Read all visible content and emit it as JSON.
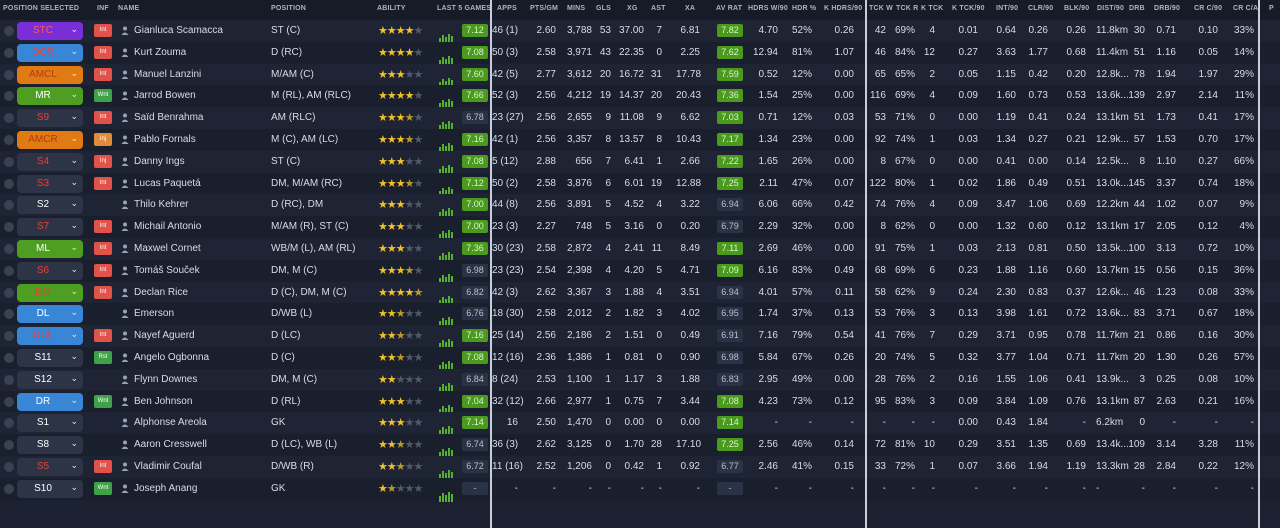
{
  "columns": {
    "position_selected": "POSITION SELECTED",
    "inf": "INF",
    "name": "NAME",
    "position": "POSITION",
    "ability": "ABILITY",
    "last5": "LAST 5 GAMES",
    "apps": "APPS",
    "pts_gm": "PTS/GM",
    "mins": "MINS",
    "gls": "GLS",
    "xg": "XG",
    "ast": "AST",
    "xa": "XA",
    "av_rat": "AV RAT",
    "hdrs_w90": "HDRS W/90",
    "hdr_pct": "HDR %",
    "khdrs90": "K HDRS/90",
    "tckw": "TCK W",
    "tckr": "TCK R",
    "ktck": "K TCK",
    "ktck90": "K TCK/90",
    "int90": "INT/90",
    "clr90": "CLR/90",
    "blk90": "BLK/90",
    "dist90": "DIST/90",
    "drb": "DRB",
    "drb90": "DRB/90",
    "crc90": "CR C/90",
    "crca": "CR C/A",
    "p": "P"
  },
  "colors": {
    "purple": "#7a2fd6",
    "blue": "#3a86d6",
    "orange": "#e07a12",
    "green": "#4e9e22",
    "dark": "#2c3446",
    "red": "#e04840",
    "text_red": "#e8423a"
  },
  "rows": [
    {
      "pos": "STC",
      "pos_style": "purple",
      "inf": "Int",
      "inf_color": "red",
      "name": "Gianluca Scamacca",
      "position": "ST (C)",
      "stars": 4,
      "half": false,
      "rating": "7.12",
      "rating_bg": "green",
      "apps": "46 (1)",
      "pts_gm": "2.60",
      "mins": "3,788",
      "gls": "53",
      "xg": "37.00",
      "ast": "7",
      "xa": "6.81",
      "av_rat": "7.82",
      "av_bg": "green",
      "hdrs_w90": "4.70",
      "hdr_pct": "52%",
      "khdrs90": "0.26",
      "tckw": "42",
      "tckr": "69%",
      "ktck": "4",
      "ktck90": "0.01",
      "int90": "0.64",
      "clr90": "0.26",
      "blk90": "0.26",
      "dist90": "11.8km",
      "drb": "30",
      "drb90": "0.71",
      "crc90": "0.10",
      "crca": "33%"
    },
    {
      "pos": "DCR",
      "pos_style": "blue",
      "inf": "Int",
      "inf_color": "red",
      "name": "Kurt Zouma",
      "position": "D (RC)",
      "stars": 4,
      "half": false,
      "rating": "7.08",
      "rating_bg": "green",
      "apps": "50 (3)",
      "pts_gm": "2.58",
      "mins": "3,971",
      "gls": "43",
      "xg": "22.35",
      "ast": "0",
      "xa": "2.25",
      "av_rat": "7.62",
      "av_bg": "green",
      "hdrs_w90": "12.94",
      "hdr_pct": "81%",
      "khdrs90": "1.07",
      "tckw": "46",
      "tckr": "84%",
      "ktck": "12",
      "ktck90": "0.27",
      "int90": "3.63",
      "clr90": "1.77",
      "blk90": "0.68",
      "dist90": "11.4km",
      "drb": "51",
      "drb90": "1.16",
      "crc90": "0.05",
      "crca": "14%"
    },
    {
      "pos": "AMCL",
      "pos_style": "orange",
      "inf": "Int",
      "inf_color": "red",
      "name": "Manuel Lanzini",
      "position": "M/AM (C)",
      "stars": 3,
      "half": false,
      "rating": "7.60",
      "rating_bg": "green",
      "apps": "42 (5)",
      "pts_gm": "2.77",
      "mins": "3,612",
      "gls": "20",
      "xg": "16.72",
      "ast": "31",
      "xa": "17.78",
      "av_rat": "7.59",
      "av_bg": "green",
      "hdrs_w90": "0.52",
      "hdr_pct": "12%",
      "khdrs90": "0.00",
      "tckw": "65",
      "tckr": "65%",
      "ktck": "2",
      "ktck90": "0.05",
      "int90": "1.15",
      "clr90": "0.42",
      "blk90": "0.20",
      "dist90": "12.8k...",
      "drb": "78",
      "drb90": "1.94",
      "crc90": "1.97",
      "crca": "29%"
    },
    {
      "pos": "MR",
      "pos_style": "green",
      "inf": "Wnt",
      "inf_color": "green",
      "name": "Jarrod Bowen",
      "position": "M (RL), AM (RLC)",
      "stars": 4,
      "half": false,
      "rating": "7.66",
      "rating_bg": "green",
      "apps": "52 (3)",
      "pts_gm": "2.56",
      "mins": "4,212",
      "gls": "19",
      "xg": "14.37",
      "ast": "20",
      "xa": "20.43",
      "av_rat": "7.36",
      "av_bg": "green",
      "hdrs_w90": "1.54",
      "hdr_pct": "25%",
      "khdrs90": "0.00",
      "tckw": "116",
      "tckr": "69%",
      "ktck": "4",
      "ktck90": "0.09",
      "int90": "1.60",
      "clr90": "0.73",
      "blk90": "0.53",
      "dist90": "13.6k...",
      "drb": "139",
      "drb90": "2.97",
      "crc90": "2.14",
      "crca": "11%"
    },
    {
      "pos": "S9",
      "pos_style": "dark",
      "inf": "Int",
      "inf_color": "red",
      "name": "Saïd Benrahma",
      "position": "AM (RLC)",
      "stars": 3,
      "half": true,
      "rating": "6.78",
      "rating_bg": "dark",
      "apps": "23 (27)",
      "pts_gm": "2.56",
      "mins": "2,655",
      "gls": "9",
      "xg": "11.08",
      "ast": "9",
      "xa": "6.62",
      "av_rat": "7.03",
      "av_bg": "green",
      "hdrs_w90": "0.71",
      "hdr_pct": "12%",
      "khdrs90": "0.03",
      "tckw": "53",
      "tckr": "71%",
      "ktck": "0",
      "ktck90": "0.00",
      "int90": "1.19",
      "clr90": "0.41",
      "blk90": "0.24",
      "dist90": "13.1km",
      "drb": "51",
      "drb90": "1.73",
      "crc90": "0.41",
      "crca": "17%"
    },
    {
      "pos": "AMCR",
      "pos_style": "orange",
      "inf": "Inj",
      "inf_color": "orange",
      "name": "Pablo Fornals",
      "position": "M (C), AM (LC)",
      "stars": 3,
      "half": true,
      "rating": "7.16",
      "rating_bg": "green",
      "apps": "42 (1)",
      "pts_gm": "2.56",
      "mins": "3,357",
      "gls": "8",
      "xg": "13.57",
      "ast": "8",
      "xa": "10.43",
      "av_rat": "7.17",
      "av_bg": "green",
      "hdrs_w90": "1.34",
      "hdr_pct": "23%",
      "khdrs90": "0.00",
      "tckw": "92",
      "tckr": "74%",
      "ktck": "1",
      "ktck90": "0.03",
      "int90": "1.34",
      "clr90": "0.27",
      "blk90": "0.21",
      "dist90": "12.9k...",
      "drb": "57",
      "drb90": "1.53",
      "crc90": "0.70",
      "crca": "17%"
    },
    {
      "pos": "S4",
      "pos_style": "dark",
      "inf": "Inj",
      "inf_color": "red",
      "name": "Danny Ings",
      "position": "ST (C)",
      "stars": 3,
      "half": false,
      "rating": "7.08",
      "rating_bg": "green",
      "apps": "5 (12)",
      "pts_gm": "2.88",
      "mins": "656",
      "gls": "7",
      "xg": "6.41",
      "ast": "1",
      "xa": "2.66",
      "av_rat": "7.22",
      "av_bg": "green",
      "hdrs_w90": "1.65",
      "hdr_pct": "26%",
      "khdrs90": "0.00",
      "tckw": "8",
      "tckr": "67%",
      "ktck": "0",
      "ktck90": "0.00",
      "int90": "0.41",
      "clr90": "0.00",
      "blk90": "0.14",
      "dist90": "12.5k...",
      "drb": "8",
      "drb90": "1.10",
      "crc90": "0.27",
      "crca": "66%"
    },
    {
      "pos": "S3",
      "pos_style": "dark",
      "inf": "Int",
      "inf_color": "red",
      "name": "Lucas Paquetá",
      "position": "DM, M/AM (RC)",
      "stars": 3,
      "half": true,
      "rating": "7.12",
      "rating_bg": "green",
      "apps": "50 (2)",
      "pts_gm": "2.58",
      "mins": "3,876",
      "gls": "6",
      "xg": "6.01",
      "ast": "19",
      "xa": "12.88",
      "av_rat": "7.25",
      "av_bg": "green",
      "hdrs_w90": "2.11",
      "hdr_pct": "47%",
      "khdrs90": "0.07",
      "tckw": "122",
      "tckr": "80%",
      "ktck": "1",
      "ktck90": "0.02",
      "int90": "1.86",
      "clr90": "0.49",
      "blk90": "0.51",
      "dist90": "13.0k...",
      "drb": "145",
      "drb90": "3.37",
      "crc90": "0.74",
      "crca": "18%"
    },
    {
      "pos": "S2",
      "pos_style": "dark",
      "inf": "",
      "inf_color": "none",
      "name": "Thilo Kehrer",
      "position": "D (RC), DM",
      "stars": 3,
      "half": false,
      "rating": "7.00",
      "rating_bg": "green",
      "apps": "44 (8)",
      "pts_gm": "2.56",
      "mins": "3,891",
      "gls": "5",
      "xg": "4.52",
      "ast": "4",
      "xa": "3.22",
      "av_rat": "6.94",
      "av_bg": "dark",
      "hdrs_w90": "6.06",
      "hdr_pct": "66%",
      "khdrs90": "0.42",
      "tckw": "74",
      "tckr": "76%",
      "ktck": "4",
      "ktck90": "0.09",
      "int90": "3.47",
      "clr90": "1.06",
      "blk90": "0.69",
      "dist90": "12.2km",
      "drb": "44",
      "drb90": "1.02",
      "crc90": "0.07",
      "crca": "9%"
    },
    {
      "pos": "S7",
      "pos_style": "dark",
      "inf": "Int",
      "inf_color": "red",
      "name": "Michail Antonio",
      "position": "M/AM (R), ST (C)",
      "stars": 3,
      "half": false,
      "rating": "7.00",
      "rating_bg": "green",
      "apps": "23 (3)",
      "pts_gm": "2.27",
      "mins": "748",
      "gls": "5",
      "xg": "3.16",
      "ast": "0",
      "xa": "0.20",
      "av_rat": "6.79",
      "av_bg": "dark",
      "hdrs_w90": "2.29",
      "hdr_pct": "32%",
      "khdrs90": "0.00",
      "tckw": "8",
      "tckr": "62%",
      "ktck": "0",
      "ktck90": "0.00",
      "int90": "1.32",
      "clr90": "0.60",
      "blk90": "0.12",
      "dist90": "13.1km",
      "drb": "17",
      "drb90": "2.05",
      "crc90": "0.12",
      "crca": "4%"
    },
    {
      "pos": "ML",
      "pos_style": "green",
      "inf": "Int",
      "inf_color": "red",
      "name": "Maxwel Cornet",
      "position": "WB/M (L), AM (RL)",
      "stars": 3,
      "half": false,
      "rating": "7.36",
      "rating_bg": "green",
      "apps": "30 (23)",
      "pts_gm": "2.58",
      "mins": "2,872",
      "gls": "4",
      "xg": "2.41",
      "ast": "11",
      "xa": "8.49",
      "av_rat": "7.11",
      "av_bg": "green",
      "hdrs_w90": "2.69",
      "hdr_pct": "46%",
      "khdrs90": "0.00",
      "tckw": "91",
      "tckr": "75%",
      "ktck": "1",
      "ktck90": "0.03",
      "int90": "2.13",
      "clr90": "0.81",
      "blk90": "0.50",
      "dist90": "13.5k...",
      "drb": "100",
      "drb90": "3.13",
      "crc90": "0.72",
      "crca": "10%"
    },
    {
      "pos": "S6",
      "pos_style": "dark",
      "inf": "Int",
      "inf_color": "red",
      "name": "Tomáš Souček",
      "position": "DM, M (C)",
      "stars": 3,
      "half": true,
      "rating": "6.98",
      "rating_bg": "dark",
      "apps": "23 (23)",
      "pts_gm": "2.54",
      "mins": "2,398",
      "gls": "4",
      "xg": "4.20",
      "ast": "5",
      "xa": "4.71",
      "av_rat": "7.09",
      "av_bg": "green",
      "hdrs_w90": "6.16",
      "hdr_pct": "83%",
      "khdrs90": "0.49",
      "tckw": "68",
      "tckr": "69%",
      "ktck": "6",
      "ktck90": "0.23",
      "int90": "1.88",
      "clr90": "1.16",
      "blk90": "0.60",
      "dist90": "13.7km",
      "drb": "15",
      "drb90": "0.56",
      "crc90": "0.15",
      "crca": "36%"
    },
    {
      "pos": "DM",
      "pos_style": "green",
      "inf": "Int",
      "inf_color": "red",
      "name": "Declan Rice",
      "position": "D (C), DM, M (C)",
      "stars": 4,
      "half": true,
      "rating": "6.82",
      "rating_bg": "dark",
      "apps": "42 (3)",
      "pts_gm": "2.62",
      "mins": "3,367",
      "gls": "3",
      "xg": "1.88",
      "ast": "4",
      "xa": "3.51",
      "av_rat": "6.94",
      "av_bg": "dark",
      "hdrs_w90": "4.01",
      "hdr_pct": "57%",
      "khdrs90": "0.11",
      "tckw": "58",
      "tckr": "62%",
      "ktck": "9",
      "ktck90": "0.24",
      "int90": "2.30",
      "clr90": "0.83",
      "blk90": "0.37",
      "dist90": "12.6k...",
      "drb": "46",
      "drb90": "1.23",
      "crc90": "0.08",
      "crca": "33%"
    },
    {
      "pos": "DL",
      "pos_style": "blue",
      "inf": "",
      "inf_color": "none",
      "name": "Emerson",
      "position": "D/WB (L)",
      "stars": 2,
      "half": true,
      "rating": "6.76",
      "rating_bg": "dark",
      "apps": "18 (30)",
      "pts_gm": "2.58",
      "mins": "2,012",
      "gls": "2",
      "xg": "1.82",
      "ast": "3",
      "xa": "4.02",
      "av_rat": "6.95",
      "av_bg": "dark",
      "hdrs_w90": "1.74",
      "hdr_pct": "37%",
      "khdrs90": "0.13",
      "tckw": "53",
      "tckr": "76%",
      "ktck": "3",
      "ktck90": "0.13",
      "int90": "3.98",
      "clr90": "1.61",
      "blk90": "0.72",
      "dist90": "13.6k...",
      "drb": "83",
      "drb90": "3.71",
      "crc90": "0.67",
      "crca": "18%"
    },
    {
      "pos": "DCL",
      "pos_style": "blue",
      "inf": "Int",
      "inf_color": "red",
      "name": "Nayef Aguerd",
      "position": "D (LC)",
      "stars": 2,
      "half": true,
      "rating": "7.16",
      "rating_bg": "green",
      "apps": "25 (14)",
      "pts_gm": "2.56",
      "mins": "2,186",
      "gls": "2",
      "xg": "1.51",
      "ast": "0",
      "xa": "0.49",
      "av_rat": "6.91",
      "av_bg": "dark",
      "hdrs_w90": "7.16",
      "hdr_pct": "79%",
      "khdrs90": "0.54",
      "tckw": "41",
      "tckr": "76%",
      "ktck": "7",
      "ktck90": "0.29",
      "int90": "3.71",
      "clr90": "0.95",
      "blk90": "0.78",
      "dist90": "11.7km",
      "drb": "21",
      "drb90": "0.86",
      "crc90": "0.16",
      "crca": "30%"
    },
    {
      "pos": "S11",
      "pos_style": "dark",
      "inf": "Rst",
      "inf_color": "green",
      "name": "Angelo Ogbonna",
      "position": "D (C)",
      "stars": 2,
      "half": true,
      "rating": "7.08",
      "rating_bg": "green",
      "apps": "12 (16)",
      "pts_gm": "2.36",
      "mins": "1,386",
      "gls": "1",
      "xg": "0.81",
      "ast": "0",
      "xa": "0.90",
      "av_rat": "6.98",
      "av_bg": "dark",
      "hdrs_w90": "5.84",
      "hdr_pct": "67%",
      "khdrs90": "0.26",
      "tckw": "20",
      "tckr": "74%",
      "ktck": "5",
      "ktck90": "0.32",
      "int90": "3.77",
      "clr90": "1.04",
      "blk90": "0.71",
      "dist90": "11.7km",
      "drb": "20",
      "drb90": "1.30",
      "crc90": "0.26",
      "crca": "57%"
    },
    {
      "pos": "S12",
      "pos_style": "dark",
      "inf": "",
      "inf_color": "none",
      "name": "Flynn Downes",
      "position": "DM, M (C)",
      "stars": 2,
      "half": false,
      "rating": "6.84",
      "rating_bg": "dark",
      "apps": "8 (24)",
      "pts_gm": "2.53",
      "mins": "1,100",
      "gls": "1",
      "xg": "1.17",
      "ast": "3",
      "xa": "1.88",
      "av_rat": "6.83",
      "av_bg": "dark",
      "hdrs_w90": "2.95",
      "hdr_pct": "49%",
      "khdrs90": "0.00",
      "tckw": "28",
      "tckr": "76%",
      "ktck": "2",
      "ktck90": "0.16",
      "int90": "1.55",
      "clr90": "1.06",
      "blk90": "0.41",
      "dist90": "13.9k...",
      "drb": "3",
      "drb90": "0.25",
      "crc90": "0.08",
      "crca": "10%"
    },
    {
      "pos": "DR",
      "pos_style": "blue",
      "inf": "Wnt",
      "inf_color": "green",
      "name": "Ben Johnson",
      "position": "D (RL)",
      "stars": 3,
      "half": false,
      "rating": "7.04",
      "rating_bg": "green",
      "apps": "32 (12)",
      "pts_gm": "2.66",
      "mins": "2,977",
      "gls": "1",
      "xg": "0.75",
      "ast": "7",
      "xa": "3.44",
      "av_rat": "7.08",
      "av_bg": "green",
      "hdrs_w90": "4.23",
      "hdr_pct": "73%",
      "khdrs90": "0.12",
      "tckw": "95",
      "tckr": "83%",
      "ktck": "3",
      "ktck90": "0.09",
      "int90": "3.84",
      "clr90": "1.09",
      "blk90": "0.76",
      "dist90": "13.1km",
      "drb": "87",
      "drb90": "2.63",
      "crc90": "0.21",
      "crca": "16%"
    },
    {
      "pos": "S1",
      "pos_style": "dark",
      "inf": "",
      "inf_color": "none",
      "name": "Alphonse Areola",
      "position": "GK",
      "stars": 3,
      "half": false,
      "rating": "7.14",
      "rating_bg": "green",
      "apps": "16",
      "pts_gm": "2.50",
      "mins": "1,470",
      "gls": "0",
      "xg": "0.00",
      "ast": "0",
      "xa": "0.00",
      "av_rat": "7.14",
      "av_bg": "green",
      "hdrs_w90": "-",
      "hdr_pct": "-",
      "khdrs90": "-",
      "tckw": "-",
      "tckr": "-",
      "ktck": "-",
      "ktck90": "0.00",
      "int90": "0.43",
      "clr90": "1.84",
      "blk90": "-",
      "dist90": "6.2km",
      "drb": "0",
      "drb90": "-",
      "crc90": "-",
      "crca": "-"
    },
    {
      "pos": "S8",
      "pos_style": "dark",
      "inf": "",
      "inf_color": "none",
      "name": "Aaron Cresswell",
      "position": "D (LC), WB (L)",
      "stars": 2,
      "half": true,
      "rating": "6.74",
      "rating_bg": "dark",
      "apps": "36 (3)",
      "pts_gm": "2.62",
      "mins": "3,125",
      "gls": "0",
      "xg": "1.70",
      "ast": "28",
      "xa": "17.10",
      "av_rat": "7.25",
      "av_bg": "green",
      "hdrs_w90": "2.56",
      "hdr_pct": "46%",
      "khdrs90": "0.14",
      "tckw": "72",
      "tckr": "81%",
      "ktck": "10",
      "ktck90": "0.29",
      "int90": "3.51",
      "clr90": "1.35",
      "blk90": "0.69",
      "dist90": "13.4k...",
      "drb": "109",
      "drb90": "3.14",
      "crc90": "3.28",
      "crca": "11%"
    },
    {
      "pos": "S5",
      "pos_style": "dark",
      "inf": "Int",
      "inf_color": "red",
      "name": "Vladimir Coufal",
      "position": "D/WB (R)",
      "stars": 2,
      "half": true,
      "rating": "6.72",
      "rating_bg": "dark",
      "apps": "11 (16)",
      "pts_gm": "2.52",
      "mins": "1,206",
      "gls": "0",
      "xg": "0.42",
      "ast": "1",
      "xa": "0.92",
      "av_rat": "6.77",
      "av_bg": "dark",
      "hdrs_w90": "2.46",
      "hdr_pct": "41%",
      "khdrs90": "0.15",
      "tckw": "33",
      "tckr": "72%",
      "ktck": "1",
      "ktck90": "0.07",
      "int90": "3.66",
      "clr90": "1.94",
      "blk90": "1.19",
      "dist90": "13.3km",
      "drb": "28",
      "drb90": "2.84",
      "crc90": "0.22",
      "crca": "12%"
    },
    {
      "pos": "S10",
      "pos_style": "dark",
      "inf": "Wnt",
      "inf_color": "green",
      "name": "Joseph Anang",
      "position": "GK",
      "stars": 1,
      "half": true,
      "rating": "-",
      "rating_bg": "dark",
      "apps": "-",
      "pts_gm": "-",
      "mins": "-",
      "gls": "-",
      "xg": "-",
      "ast": "-",
      "xa": "-",
      "av_rat": "-",
      "av_bg": "dark",
      "hdrs_w90": "-",
      "hdr_pct": "-",
      "khdrs90": "-",
      "tckw": "-",
      "tckr": "-",
      "ktck": "-",
      "ktck90": "-",
      "int90": "-",
      "clr90": "-",
      "blk90": "-",
      "dist90": "-",
      "drb": "-",
      "drb90": "-",
      "crc90": "-",
      "crca": "-"
    }
  ]
}
